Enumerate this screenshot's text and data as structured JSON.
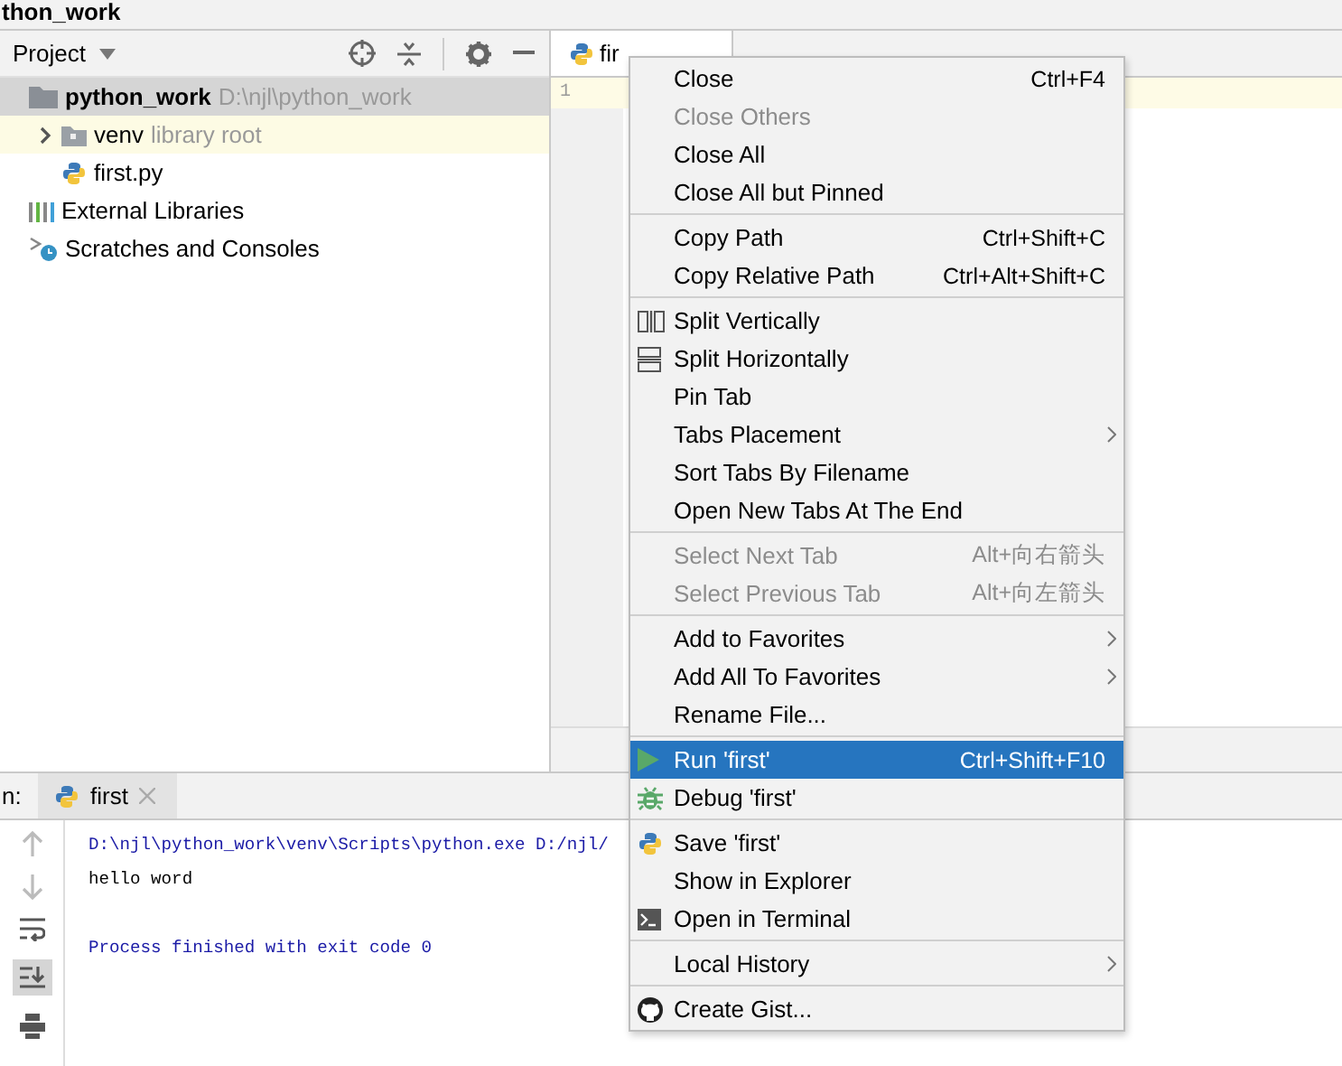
{
  "window": {
    "title": "thon_work"
  },
  "project_panel": {
    "title": "Project",
    "tree": [
      {
        "name": "python_work",
        "hint": "D:\\njl\\python_work",
        "kind": "folder",
        "selected": true,
        "children": [
          {
            "name": "venv",
            "hint": "library root",
            "kind": "folder-lib",
            "expanded": false,
            "highlighted": true
          },
          {
            "name": "first.py",
            "kind": "python-file"
          }
        ]
      },
      {
        "name": "External Libraries",
        "kind": "libraries"
      },
      {
        "name": "Scratches and Consoles",
        "kind": "scratches"
      }
    ]
  },
  "editor": {
    "tabs": [
      {
        "label": "fir",
        "selected": true
      }
    ],
    "line_numbers": [
      "1"
    ]
  },
  "context_menu": {
    "groups": [
      [
        {
          "label": "Close",
          "shortcut": "Ctrl+F4",
          "disabled": false
        },
        {
          "label": "Close Others",
          "disabled": true
        },
        {
          "label": "Close All",
          "disabled": false
        },
        {
          "label": "Close All but Pinned",
          "disabled": false
        }
      ],
      [
        {
          "label": "Copy Path",
          "shortcut": "Ctrl+Shift+C",
          "disabled": false
        },
        {
          "label": "Copy Relative Path",
          "shortcut": "Ctrl+Alt+Shift+C",
          "disabled": false
        }
      ],
      [
        {
          "label": "Split Vertically",
          "kind": "split-vertical",
          "disabled": false
        },
        {
          "label": "Split Horizontally",
          "kind": "split-horizontal",
          "disabled": false
        },
        {
          "label": "Pin Tab",
          "disabled": false
        },
        {
          "label": "Tabs Placement",
          "submenu": true,
          "disabled": false
        },
        {
          "label": "Sort Tabs By Filename",
          "disabled": false
        },
        {
          "label": "Open New Tabs At The End",
          "disabled": false
        }
      ],
      [
        {
          "label": "Select Next Tab",
          "shortcut": "Alt+向右箭头",
          "disabled": true
        },
        {
          "label": "Select Previous Tab",
          "shortcut": "Alt+向左箭头",
          "disabled": true
        }
      ],
      [
        {
          "label": "Add to Favorites",
          "submenu": true,
          "disabled": false
        },
        {
          "label": "Add All To Favorites",
          "submenu": true,
          "disabled": false
        },
        {
          "label": "Rename File...",
          "disabled": false
        }
      ],
      [
        {
          "label": "Run 'first'",
          "shortcut": "Ctrl+Shift+F10",
          "kind": "run",
          "selected": true,
          "disabled": false
        },
        {
          "label": "Debug 'first'",
          "kind": "debug",
          "disabled": false
        }
      ],
      [
        {
          "label": "Save 'first'",
          "kind": "python",
          "disabled": false
        },
        {
          "label": "Show in Explorer",
          "disabled": false
        },
        {
          "label": "Open in Terminal",
          "kind": "terminal",
          "disabled": false
        }
      ],
      [
        {
          "label": "Local History",
          "submenu": true,
          "disabled": false
        }
      ],
      [
        {
          "label": "Create Gist...",
          "kind": "github",
          "disabled": false
        }
      ]
    ]
  },
  "run_panel": {
    "label": "n:",
    "tabs": [
      {
        "label": "first",
        "selected": true
      }
    ],
    "output": [
      {
        "text": "D:\\njl\\python_work\\venv\\Scripts\\python.exe D:/njl/",
        "kind": "system"
      },
      {
        "text": "hello word",
        "kind": "stdout"
      },
      {
        "kind": "blank"
      },
      {
        "text": "Process finished with exit code 0",
        "kind": "system"
      }
    ]
  }
}
